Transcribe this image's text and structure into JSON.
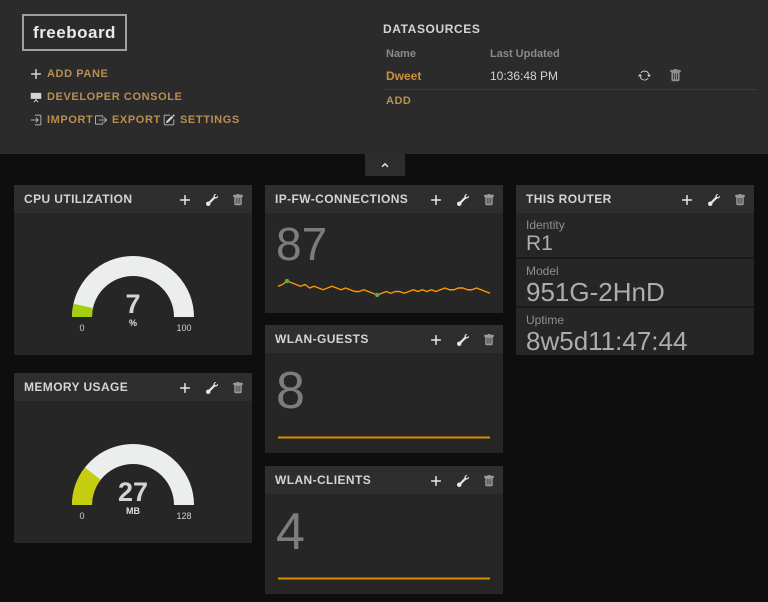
{
  "header": {
    "logo": "freeboard",
    "toolbar": {
      "add_pane": "ADD PANE",
      "developer_console": "DEVELOPER CONSOLE",
      "import": "IMPORT",
      "export": "EXPORT",
      "settings": "SETTINGS"
    },
    "datasources": {
      "title": "DATASOURCES",
      "columns": {
        "name": "Name",
        "last_updated": "Last Updated"
      },
      "rows": [
        {
          "name": "Dweet",
          "last_updated": "10:36:48 PM"
        }
      ],
      "add_label": "ADD"
    }
  },
  "collapse_tab": {
    "icon": "chevron-up"
  },
  "panes": {
    "cpu": {
      "title": "CPU UTILIZATION",
      "widget": "gauge",
      "value": 7,
      "units": "%",
      "min": 0,
      "max": 100,
      "color": "#a6ce10"
    },
    "memory": {
      "title": "MEMORY USAGE",
      "widget": "gauge",
      "value": 27,
      "units": "MB",
      "min": 0,
      "max": 128,
      "color": "#c6cc10"
    },
    "ipfw": {
      "title": "IP-FW-CONNECTIONS",
      "widget": "text+sparkline",
      "value": 87,
      "sparkline": [
        87,
        88,
        90,
        89,
        88,
        87,
        88,
        86,
        87,
        86,
        85,
        86,
        87,
        86,
        85,
        86,
        85,
        84,
        84,
        85,
        84,
        83,
        82,
        83,
        84,
        83,
        84,
        84,
        83,
        84,
        85,
        84,
        85,
        84,
        85,
        84,
        85,
        86,
        85,
        85,
        86,
        86,
        85,
        85,
        86,
        85,
        84,
        83
      ]
    },
    "wlan_guests": {
      "title": "WLAN-GUESTS",
      "widget": "text+sparkline",
      "value": 8,
      "sparkline": [
        8,
        8
      ]
    },
    "wlan_clients": {
      "title": "WLAN-CLIENTS",
      "widget": "text+sparkline",
      "value": 4,
      "sparkline": [
        4,
        4
      ]
    },
    "router": {
      "title": "THIS ROUTER",
      "fields": [
        {
          "label": "Identity",
          "value": "R1"
        },
        {
          "label": "Model",
          "value": "951G-2HnD"
        },
        {
          "label": "Uptime",
          "value": "8w5d11:47:44"
        }
      ]
    }
  },
  "chart_data": [
    {
      "type": "gauge",
      "title": "CPU UTILIZATION",
      "value": 7,
      "units": "%",
      "min": 0,
      "max": 100
    },
    {
      "type": "gauge",
      "title": "MEMORY USAGE",
      "value": 27,
      "units": "MB",
      "min": 0,
      "max": 128
    },
    {
      "type": "line",
      "title": "IP-FW-CONNECTIONS",
      "current": 87,
      "ylim": [
        82,
        90
      ],
      "values": [
        87,
        88,
        90,
        89,
        88,
        87,
        88,
        86,
        87,
        86,
        85,
        86,
        87,
        86,
        85,
        86,
        85,
        84,
        84,
        85,
        84,
        83,
        82,
        83,
        84,
        83,
        84,
        84,
        83,
        84,
        85,
        84,
        85,
        84,
        85,
        84,
        85,
        86,
        85,
        85,
        86,
        86,
        85,
        85,
        86,
        85,
        84,
        83
      ],
      "annotations": "green dots mark series max (90) and min (82)"
    },
    {
      "type": "line",
      "title": "WLAN-GUESTS",
      "current": 8,
      "values": [
        8,
        8
      ]
    },
    {
      "type": "line",
      "title": "WLAN-CLIENTS",
      "current": 4,
      "values": [
        4,
        4
      ]
    }
  ],
  "colors": {
    "header_bg": "#2b2b2b",
    "board_bg": "#0e0e0e",
    "pane_bg": "#262626",
    "link_tan": "#b88f51",
    "datasource_orange": "#c9913d",
    "spark_orange": "#ff9800",
    "spark_flat_orange": "#e08b00",
    "spark_dot_green": "#5aa85a",
    "gauge_track": "#eceded",
    "gauge_cpu_fill": "#a6ce10",
    "gauge_mem_fill": "#c6cc10"
  }
}
